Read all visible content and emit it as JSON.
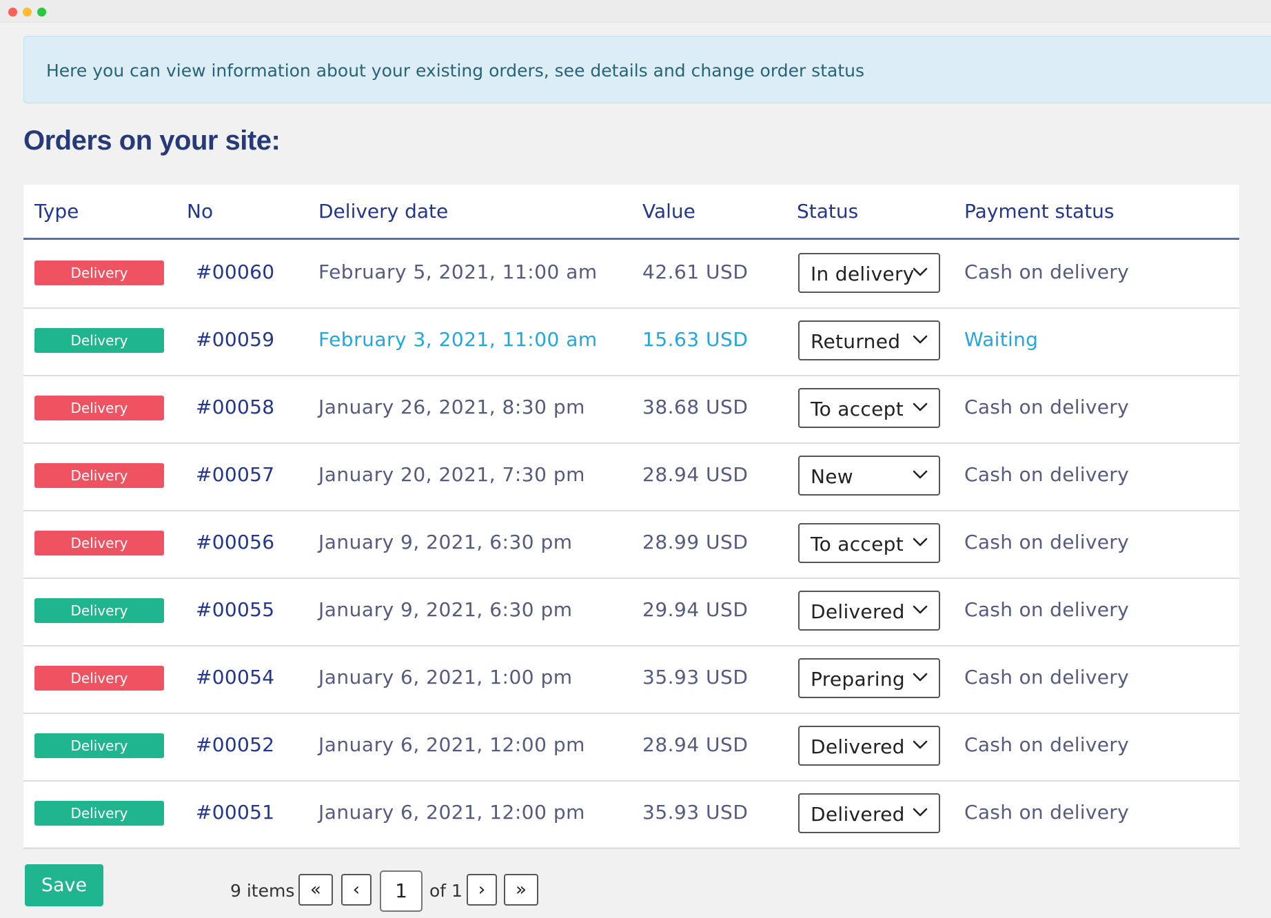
{
  "notice": {
    "text": "Here you can view information about your existing orders, see details and change order status"
  },
  "page": {
    "title": "Orders on your site:"
  },
  "table": {
    "headers": {
      "type": "Type",
      "no": "No",
      "delivery_date": "Delivery date",
      "value": "Value",
      "status": "Status",
      "payment_status": "Payment status"
    },
    "rows": [
      {
        "type": "Delivery",
        "type_color": "#ef5261",
        "no": "#00060",
        "date": "February 5, 2021, 11:00 am",
        "value": "42.61 USD",
        "status": "In delivery",
        "payment": "Cash on delivery"
      },
      {
        "type": "Delivery",
        "type_color": "#1fb58f",
        "no": "#00059",
        "date": "February 3, 2021, 11:00 am",
        "value": "15.63 USD",
        "status": "Returned",
        "payment": "Waiting",
        "highlight_color": "#22a6e0"
      },
      {
        "type": "Delivery",
        "type_color": "#ef5261",
        "no": "#00058",
        "date": "January 26, 2021, 8:30 pm",
        "value": "38.68 USD",
        "status": "To accept",
        "payment": "Cash on delivery"
      },
      {
        "type": "Delivery",
        "type_color": "#ef5261",
        "no": "#00057",
        "date": "January 20, 2021, 7:30 pm",
        "value": "28.94 USD",
        "status": "New",
        "payment": "Cash on delivery"
      },
      {
        "type": "Delivery",
        "type_color": "#ef5261",
        "no": "#00056",
        "date": "January 9, 2021, 6:30 pm",
        "value": "28.99 USD",
        "status": "To accept",
        "payment": "Cash on delivery"
      },
      {
        "type": "Delivery",
        "type_color": "#1fb58f",
        "no": "#00055",
        "date": "January 9, 2021, 6:30 pm",
        "value": "29.94 USD",
        "status": "Delivered",
        "payment": "Cash on delivery"
      },
      {
        "type": "Delivery",
        "type_color": "#ef5261",
        "no": "#00054",
        "date": "January 6, 2021, 1:00 pm",
        "value": "35.93 USD",
        "status": "Preparing",
        "payment": "Cash on delivery"
      },
      {
        "type": "Delivery",
        "type_color": "#1fb58f",
        "no": "#00052",
        "date": "January 6, 2021, 12:00 pm",
        "value": "28.94 USD",
        "status": "Delivered",
        "payment": "Cash on delivery"
      },
      {
        "type": "Delivery",
        "type_color": "#1fb58f",
        "no": "#00051",
        "date": "January 6, 2021, 12:00 pm",
        "value": "35.93 USD",
        "status": "Delivered",
        "payment": "Cash on delivery"
      }
    ]
  },
  "footer": {
    "save_label": "Save",
    "items_count": "9 items",
    "first_label": "«",
    "prev_label": "‹",
    "page_value": "1",
    "of_label": "of 1",
    "next_label": "›",
    "last_label": "»"
  },
  "colors": {
    "accent_green": "#1fb58f",
    "accent_red": "#ef5261",
    "heading_blue": "#263a78",
    "link_blue": "#22a6e0"
  },
  "icons": {
    "status_dropdown": "chevron-down-icon",
    "window_controls": [
      "close-dot",
      "minimize-dot",
      "zoom-dot"
    ]
  }
}
